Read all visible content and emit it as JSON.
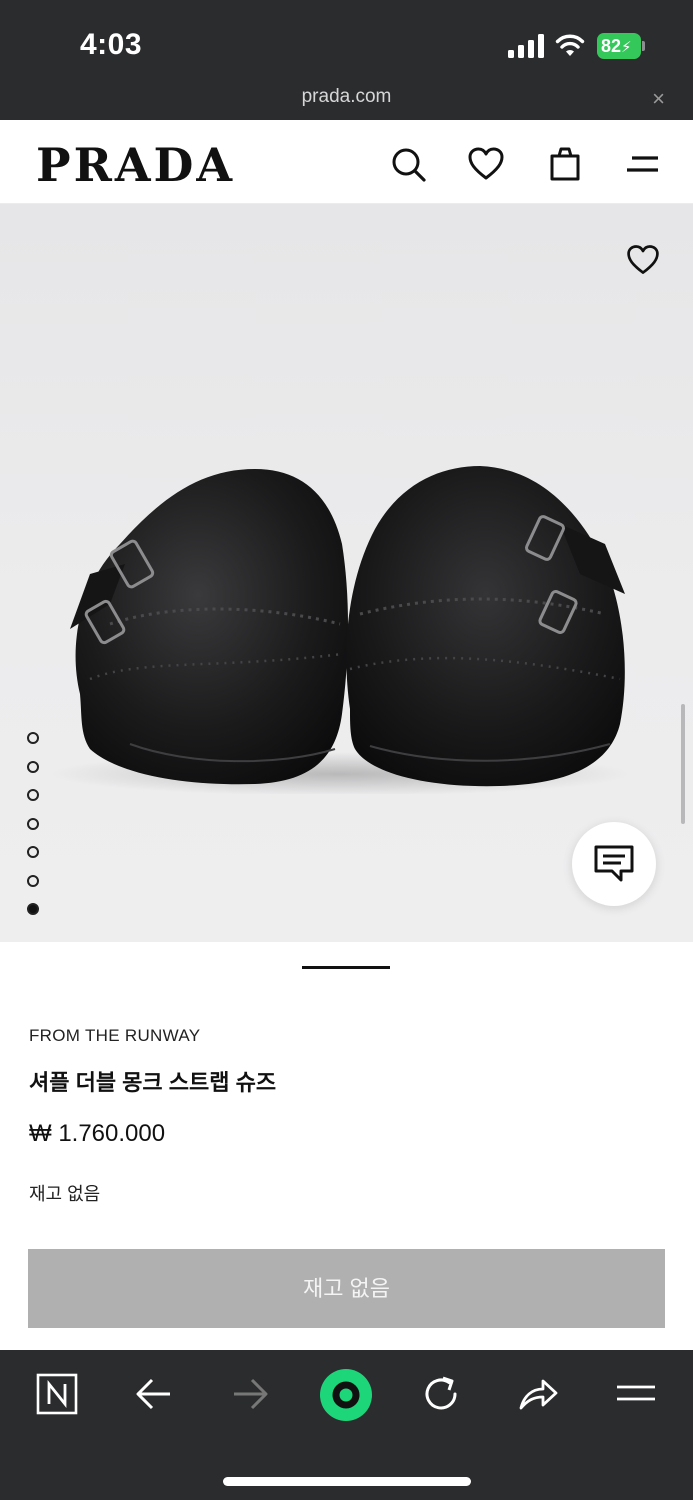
{
  "status": {
    "time": "4:03",
    "battery": "82"
  },
  "browser": {
    "url": "prada.com",
    "close": "×"
  },
  "site": {
    "logo": "PRADA"
  },
  "gallery": {
    "total_images": 7,
    "active_index": 6
  },
  "product": {
    "eyebrow": "FROM THE RUNWAY",
    "name": "셔플 더블 몽크 스트랩 슈즈",
    "price": "₩ 1.760.000",
    "stock_status": "재고 없음",
    "button_label": "재고 없음"
  },
  "colors": {
    "chrome_bg": "#2b2c2e",
    "battery_green": "#34c759",
    "button_disabled": "#b0b0b0",
    "toolbar_accent": "#1dd67a"
  }
}
